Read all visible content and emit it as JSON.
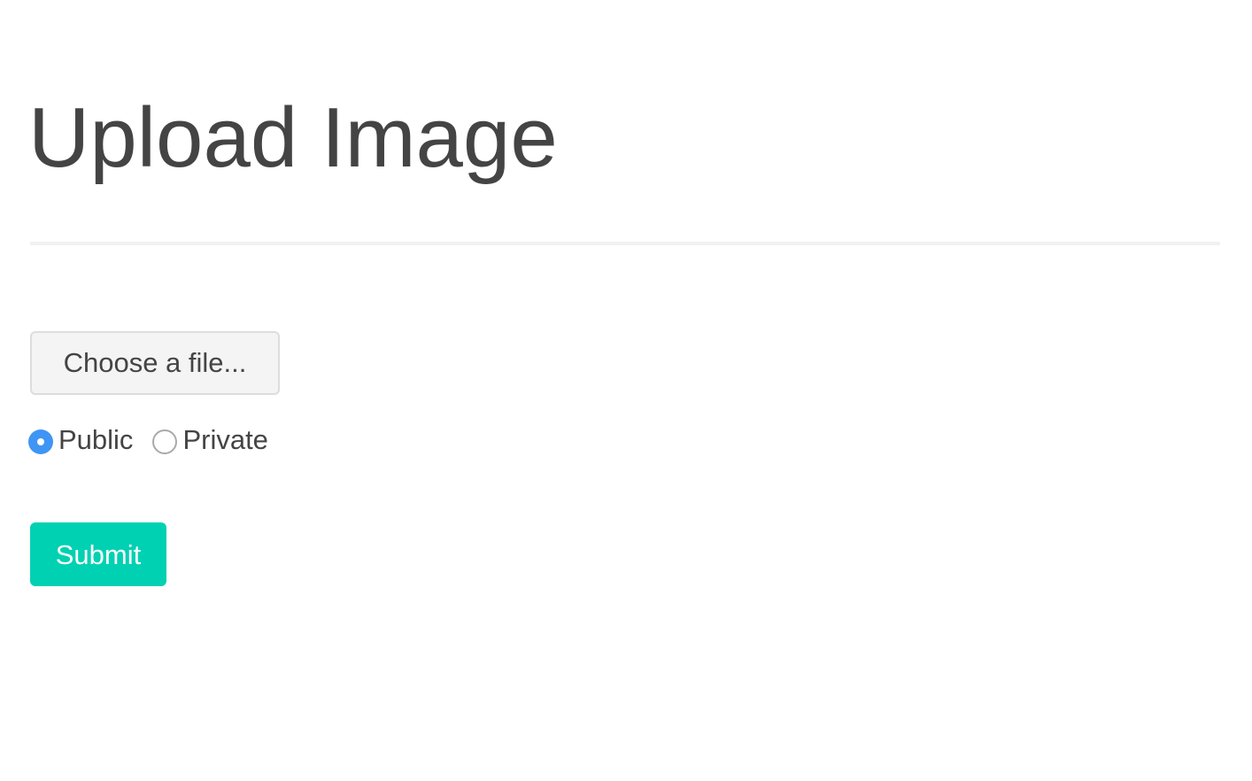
{
  "page": {
    "title": "Upload Image"
  },
  "form": {
    "file_button_label": "Choose a file...",
    "visibility": {
      "options": [
        {
          "label": "Public",
          "checked": true
        },
        {
          "label": "Private",
          "checked": false
        }
      ],
      "selected": "Public"
    },
    "submit_label": "Submit"
  },
  "colors": {
    "title_text": "#444444",
    "divider": "#f1f1f1",
    "file_button_bg": "#f4f4f4",
    "radio_checked": "#3f95f4",
    "submit_bg": "#00d1b2",
    "submit_text": "#ffffff"
  }
}
